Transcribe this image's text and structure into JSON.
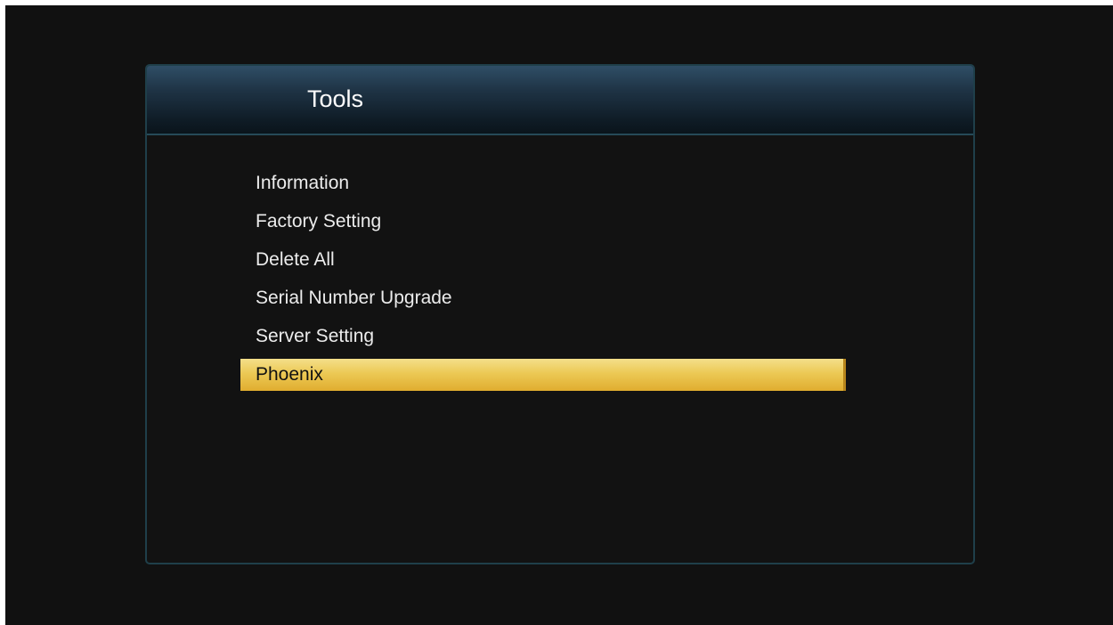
{
  "panel": {
    "title": "Tools"
  },
  "menu": {
    "items": [
      {
        "label": "Information"
      },
      {
        "label": "Factory Setting"
      },
      {
        "label": "Delete All"
      },
      {
        "label": "Serial Number Upgrade"
      },
      {
        "label": "Server Setting"
      },
      {
        "label": "Phoenix"
      }
    ],
    "selected_index": 5
  },
  "colors": {
    "highlight": "#ecc955",
    "background": "#111111",
    "header": "#1f3446"
  }
}
